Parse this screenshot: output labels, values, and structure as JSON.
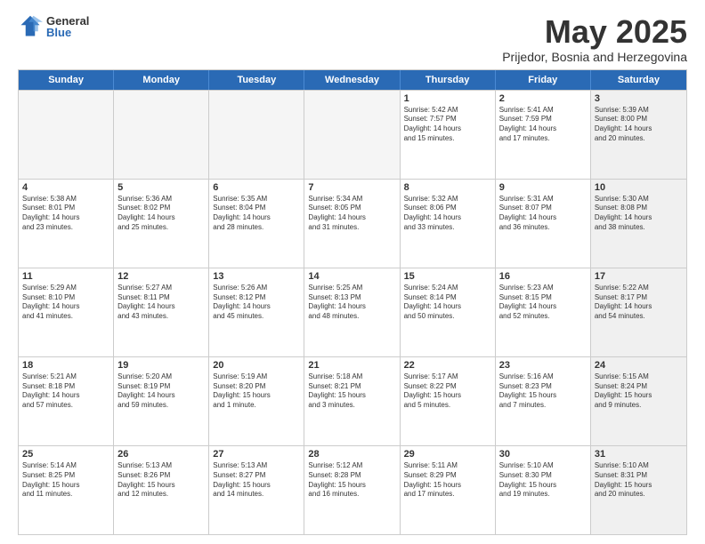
{
  "logo": {
    "general": "General",
    "blue": "Blue"
  },
  "header": {
    "month": "May 2025",
    "location": "Prijedor, Bosnia and Herzegovina"
  },
  "dayHeaders": [
    "Sunday",
    "Monday",
    "Tuesday",
    "Wednesday",
    "Thursday",
    "Friday",
    "Saturday"
  ],
  "weeks": [
    [
      {
        "num": "",
        "info": "",
        "empty": true
      },
      {
        "num": "",
        "info": "",
        "empty": true
      },
      {
        "num": "",
        "info": "",
        "empty": true
      },
      {
        "num": "",
        "info": "",
        "empty": true
      },
      {
        "num": "1",
        "info": "Sunrise: 5:42 AM\nSunset: 7:57 PM\nDaylight: 14 hours\nand 15 minutes.",
        "empty": false
      },
      {
        "num": "2",
        "info": "Sunrise: 5:41 AM\nSunset: 7:59 PM\nDaylight: 14 hours\nand 17 minutes.",
        "empty": false
      },
      {
        "num": "3",
        "info": "Sunrise: 5:39 AM\nSunset: 8:00 PM\nDaylight: 14 hours\nand 20 minutes.",
        "empty": false,
        "shaded": true
      }
    ],
    [
      {
        "num": "4",
        "info": "Sunrise: 5:38 AM\nSunset: 8:01 PM\nDaylight: 14 hours\nand 23 minutes.",
        "empty": false
      },
      {
        "num": "5",
        "info": "Sunrise: 5:36 AM\nSunset: 8:02 PM\nDaylight: 14 hours\nand 25 minutes.",
        "empty": false
      },
      {
        "num": "6",
        "info": "Sunrise: 5:35 AM\nSunset: 8:04 PM\nDaylight: 14 hours\nand 28 minutes.",
        "empty": false
      },
      {
        "num": "7",
        "info": "Sunrise: 5:34 AM\nSunset: 8:05 PM\nDaylight: 14 hours\nand 31 minutes.",
        "empty": false
      },
      {
        "num": "8",
        "info": "Sunrise: 5:32 AM\nSunset: 8:06 PM\nDaylight: 14 hours\nand 33 minutes.",
        "empty": false
      },
      {
        "num": "9",
        "info": "Sunrise: 5:31 AM\nSunset: 8:07 PM\nDaylight: 14 hours\nand 36 minutes.",
        "empty": false
      },
      {
        "num": "10",
        "info": "Sunrise: 5:30 AM\nSunset: 8:08 PM\nDaylight: 14 hours\nand 38 minutes.",
        "empty": false,
        "shaded": true
      }
    ],
    [
      {
        "num": "11",
        "info": "Sunrise: 5:29 AM\nSunset: 8:10 PM\nDaylight: 14 hours\nand 41 minutes.",
        "empty": false
      },
      {
        "num": "12",
        "info": "Sunrise: 5:27 AM\nSunset: 8:11 PM\nDaylight: 14 hours\nand 43 minutes.",
        "empty": false
      },
      {
        "num": "13",
        "info": "Sunrise: 5:26 AM\nSunset: 8:12 PM\nDaylight: 14 hours\nand 45 minutes.",
        "empty": false
      },
      {
        "num": "14",
        "info": "Sunrise: 5:25 AM\nSunset: 8:13 PM\nDaylight: 14 hours\nand 48 minutes.",
        "empty": false
      },
      {
        "num": "15",
        "info": "Sunrise: 5:24 AM\nSunset: 8:14 PM\nDaylight: 14 hours\nand 50 minutes.",
        "empty": false
      },
      {
        "num": "16",
        "info": "Sunrise: 5:23 AM\nSunset: 8:15 PM\nDaylight: 14 hours\nand 52 minutes.",
        "empty": false
      },
      {
        "num": "17",
        "info": "Sunrise: 5:22 AM\nSunset: 8:17 PM\nDaylight: 14 hours\nand 54 minutes.",
        "empty": false,
        "shaded": true
      }
    ],
    [
      {
        "num": "18",
        "info": "Sunrise: 5:21 AM\nSunset: 8:18 PM\nDaylight: 14 hours\nand 57 minutes.",
        "empty": false
      },
      {
        "num": "19",
        "info": "Sunrise: 5:20 AM\nSunset: 8:19 PM\nDaylight: 14 hours\nand 59 minutes.",
        "empty": false
      },
      {
        "num": "20",
        "info": "Sunrise: 5:19 AM\nSunset: 8:20 PM\nDaylight: 15 hours\nand 1 minute.",
        "empty": false
      },
      {
        "num": "21",
        "info": "Sunrise: 5:18 AM\nSunset: 8:21 PM\nDaylight: 15 hours\nand 3 minutes.",
        "empty": false
      },
      {
        "num": "22",
        "info": "Sunrise: 5:17 AM\nSunset: 8:22 PM\nDaylight: 15 hours\nand 5 minutes.",
        "empty": false
      },
      {
        "num": "23",
        "info": "Sunrise: 5:16 AM\nSunset: 8:23 PM\nDaylight: 15 hours\nand 7 minutes.",
        "empty": false
      },
      {
        "num": "24",
        "info": "Sunrise: 5:15 AM\nSunset: 8:24 PM\nDaylight: 15 hours\nand 9 minutes.",
        "empty": false,
        "shaded": true
      }
    ],
    [
      {
        "num": "25",
        "info": "Sunrise: 5:14 AM\nSunset: 8:25 PM\nDaylight: 15 hours\nand 11 minutes.",
        "empty": false
      },
      {
        "num": "26",
        "info": "Sunrise: 5:13 AM\nSunset: 8:26 PM\nDaylight: 15 hours\nand 12 minutes.",
        "empty": false
      },
      {
        "num": "27",
        "info": "Sunrise: 5:13 AM\nSunset: 8:27 PM\nDaylight: 15 hours\nand 14 minutes.",
        "empty": false
      },
      {
        "num": "28",
        "info": "Sunrise: 5:12 AM\nSunset: 8:28 PM\nDaylight: 15 hours\nand 16 minutes.",
        "empty": false
      },
      {
        "num": "29",
        "info": "Sunrise: 5:11 AM\nSunset: 8:29 PM\nDaylight: 15 hours\nand 17 minutes.",
        "empty": false
      },
      {
        "num": "30",
        "info": "Sunrise: 5:10 AM\nSunset: 8:30 PM\nDaylight: 15 hours\nand 19 minutes.",
        "empty": false
      },
      {
        "num": "31",
        "info": "Sunrise: 5:10 AM\nSunset: 8:31 PM\nDaylight: 15 hours\nand 20 minutes.",
        "empty": false,
        "shaded": true
      }
    ]
  ]
}
